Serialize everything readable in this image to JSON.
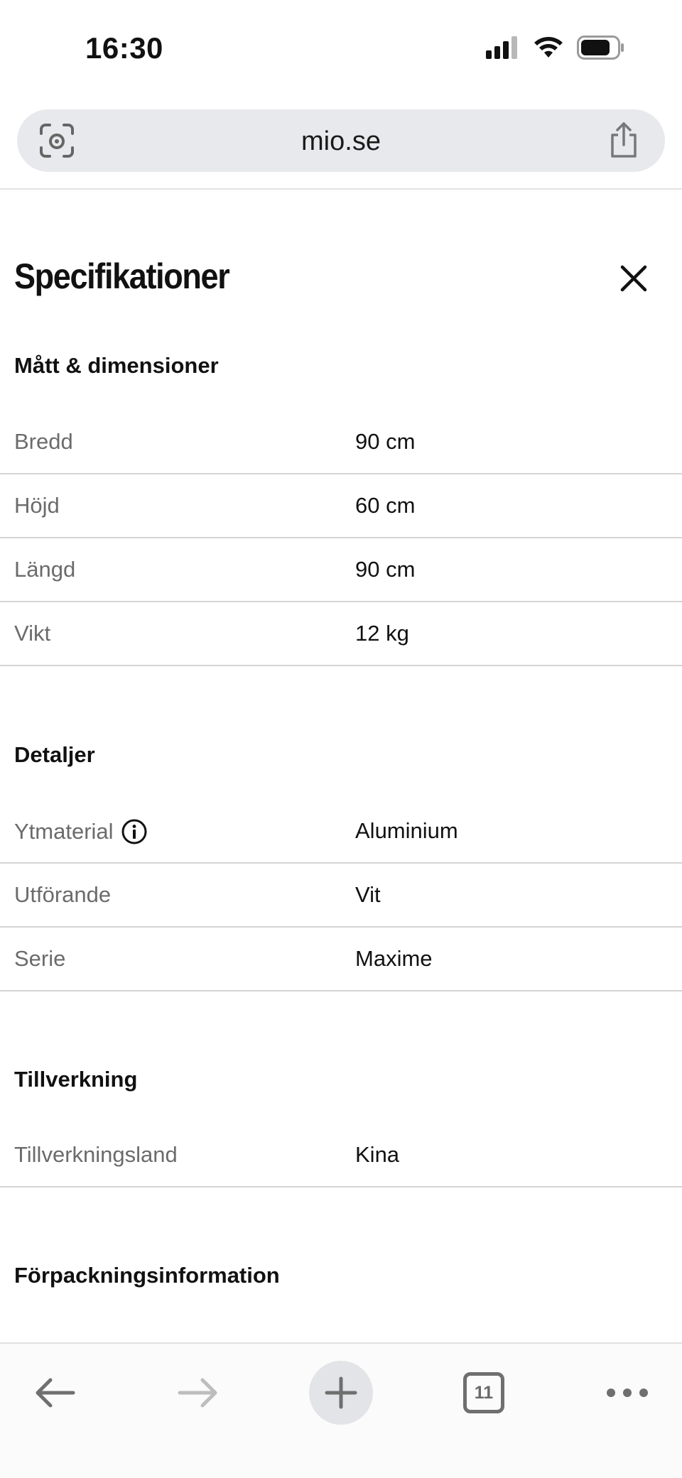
{
  "status_bar": {
    "time": "16:30"
  },
  "browser": {
    "url": "mio.se",
    "tabs_count": "11"
  },
  "page": {
    "title": "Specifikationer",
    "sections": [
      {
        "title": "Mått & dimensioner",
        "rows": [
          {
            "label": "Bredd",
            "value": "90 cm"
          },
          {
            "label": "Höjd",
            "value": "60 cm"
          },
          {
            "label": "Längd",
            "value": "90 cm"
          },
          {
            "label": "Vikt",
            "value": "12 kg"
          }
        ]
      },
      {
        "title": "Detaljer",
        "rows": [
          {
            "label": "Ytmaterial",
            "value": "Aluminium",
            "icon": "info-icon"
          },
          {
            "label": "Utförande",
            "value": "Vit"
          },
          {
            "label": "Serie",
            "value": "Maxime"
          }
        ]
      },
      {
        "title": "Tillverkning",
        "rows": [
          {
            "label": "Tillverkningsland",
            "value": "Kina"
          }
        ]
      },
      {
        "title": "Förpackningsinformation",
        "rows": []
      }
    ]
  },
  "icons": {
    "lens": "visual-search-icon",
    "share": "share-icon",
    "close": "close-icon",
    "back": "back-arrow-icon",
    "forward": "forward-arrow-icon",
    "new_tab": "plus-icon",
    "tabs": "tabs-icon",
    "more": "more-icon"
  }
}
